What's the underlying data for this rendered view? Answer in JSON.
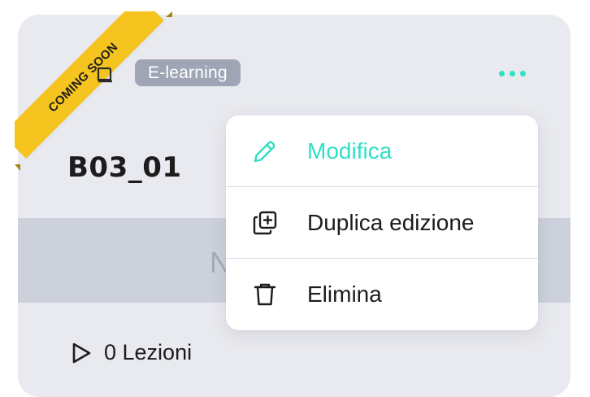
{
  "card": {
    "ribbon_label": "COMING SOON",
    "badge": "E-learning",
    "title": "B03_01",
    "band_text": "N",
    "lessons": "0 Lezioni",
    "type_icon": "book-icon",
    "more_icon": "more-dots-icon",
    "play_icon": "play-icon"
  },
  "menu": {
    "items": [
      {
        "label": "Modifica",
        "icon": "pencil-icon"
      },
      {
        "label": "Duplica edizione",
        "icon": "duplicate-icon"
      },
      {
        "label": "Elimina",
        "icon": "trash-icon"
      }
    ]
  },
  "colors": {
    "accent": "#2ee0c4",
    "ribbon": "#f6c41e",
    "badge_bg": "#9fa5b5",
    "card_bg": "#e9eaef"
  }
}
